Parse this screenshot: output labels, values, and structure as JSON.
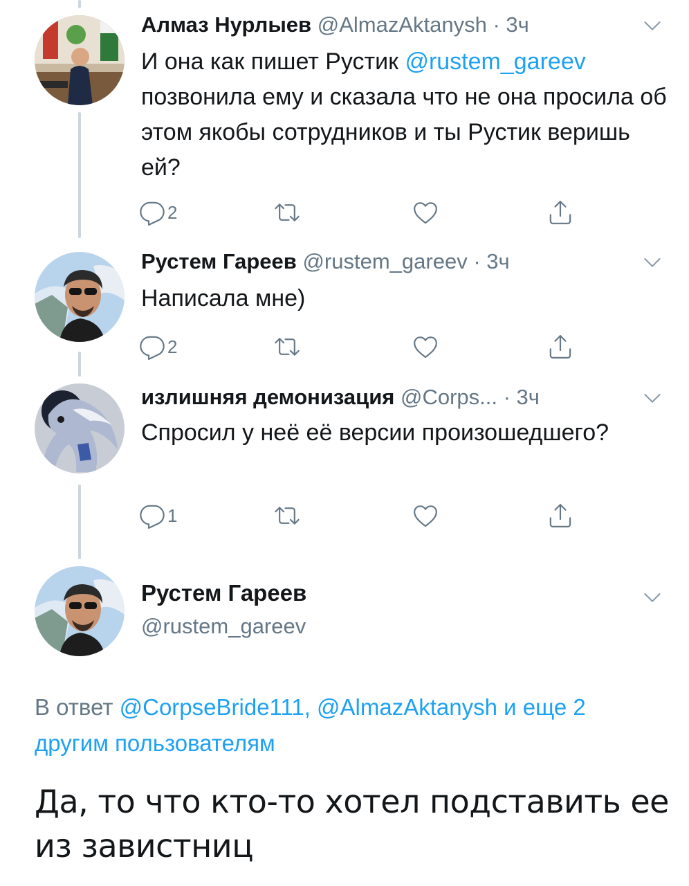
{
  "tweets": [
    {
      "name": "Алмаз Нурлыев",
      "handle": "@AlmazAktanysh",
      "time": "· 3ч",
      "text_before": "И она как пишет Рустик ",
      "mention": "@rustem_gareev",
      "text_after": " позвонила ему и сказала что не она просила об этом якобы сотрудников и ты Рустик веришь ей?",
      "replies": "2",
      "retweets": "",
      "likes": ""
    },
    {
      "name": "Рустем Гареев",
      "handle": "@rustem_gareev",
      "time": "· 3ч",
      "text": "Написала мне)",
      "replies": "2",
      "retweets": "",
      "likes": ""
    },
    {
      "name": "излишняя демонизация",
      "handle": "@Corps...",
      "time": "· 3ч",
      "text": "Спросил у неё её версии произошедшего?",
      "replies": "1",
      "retweets": "",
      "likes": ""
    }
  ],
  "main_tweet": {
    "name": "Рустем Гареев",
    "handle": "@rustem_gareev",
    "reply_prefix": "В ответ ",
    "reply_mention_1": "@CorpseBride111",
    "reply_sep": ", ",
    "reply_mention_2": "@AlmazAktanysh",
    "reply_more": " и еще 2 другим пользователям",
    "text": "Да, то что кто-то хотел подставить ее из завистниц"
  },
  "icons": {
    "reply": "reply-icon",
    "retweet": "retweet-icon",
    "like": "heart-icon",
    "share": "share-icon",
    "menu": "chevron-down-icon"
  },
  "colors": {
    "link": "#1da1f2",
    "secondary": "#657786",
    "text": "#14171a",
    "thread_line": "#ccd6dd"
  }
}
